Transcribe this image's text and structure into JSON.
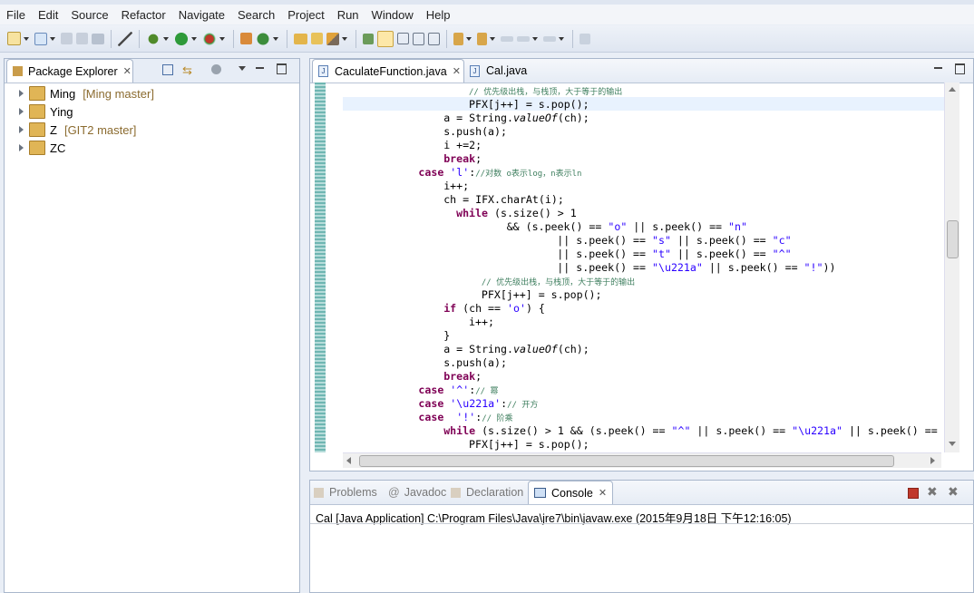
{
  "menu": [
    "File",
    "Edit",
    "Source",
    "Refactor",
    "Navigate",
    "Search",
    "Project",
    "Run",
    "Window",
    "Help"
  ],
  "package_explorer": {
    "tab_label": "Package Explorer",
    "projects": [
      {
        "name": "Ming",
        "branch": "[Ming master]"
      },
      {
        "name": "Ying",
        "branch": ""
      },
      {
        "name": "Z",
        "branch": "[GIT2 master]"
      },
      {
        "name": "ZC",
        "branch": ""
      }
    ]
  },
  "editor": {
    "tabs": [
      "CaculateFunction.java",
      "Cal.java"
    ],
    "lines": [
      {
        "indent": 20,
        "html": "<span class='cm'>// 优先级出栈，与栈顶，大于等于的输出</span>"
      },
      {
        "indent": 20,
        "html": "PFX[j++] = s.pop();",
        "hl": true
      },
      {
        "indent": 16,
        "html": "a = String.<span class='it'>valueOf</span>(ch);"
      },
      {
        "indent": 16,
        "html": "s.push(a);"
      },
      {
        "indent": 16,
        "html": "i +=2;"
      },
      {
        "indent": 16,
        "html": "<span class='kw'>break</span>;"
      },
      {
        "indent": 12,
        "html": "<span class='kw'>case</span> <span class='str'>'l'</span>:<span class='cm'>//对数 o表示log，n表示ln</span>"
      },
      {
        "indent": 16,
        "html": "i++;"
      },
      {
        "indent": 16,
        "html": "ch = IFX.charAt(i);"
      },
      {
        "indent": 18,
        "html": "<span class='kw'>while</span> (s.size() &gt; 1"
      },
      {
        "indent": 26,
        "html": "&amp;&amp; (s.peek() == <span class='str'>\"o\"</span> || s.peek() == <span class='str'>\"n\"</span>"
      },
      {
        "indent": 34,
        "html": "|| s.peek() == <span class='str'>\"s\"</span> || s.peek() == <span class='str'>\"c\"</span>"
      },
      {
        "indent": 34,
        "html": "|| s.peek() == <span class='str'>\"t\"</span> || s.peek() == <span class='str'>\"^\"</span>"
      },
      {
        "indent": 34,
        "html": "|| s.peek() == <span class='str'>\"\\u221a\"</span> || s.peek() == <span class='str'>\"!\"</span>))"
      },
      {
        "indent": 22,
        "html": "<span class='cm'>// 优先级出栈，与栈顶，大于等于的输出</span>"
      },
      {
        "indent": 22,
        "html": "PFX[j++] = s.pop();"
      },
      {
        "indent": 16,
        "html": "<span class='kw'>if</span> (ch == <span class='str'>'o'</span>) {"
      },
      {
        "indent": 20,
        "html": "i++;"
      },
      {
        "indent": 16,
        "html": "}"
      },
      {
        "indent": 16,
        "html": "a = String.<span class='it'>valueOf</span>(ch);"
      },
      {
        "indent": 16,
        "html": "s.push(a);"
      },
      {
        "indent": 16,
        "html": "<span class='kw'>break</span>;"
      },
      {
        "indent": 12,
        "html": "<span class='kw'>case</span> <span class='str'>'^'</span>:<span class='cm'>// 幂</span>"
      },
      {
        "indent": 12,
        "html": "<span class='kw'>case</span> <span class='str'>'\\u221a'</span>:<span class='cm'>// 开方</span>"
      },
      {
        "indent": 12,
        "html": "<span class='kw'>case</span>  <span class='str'>'!'</span>:<span class='cm'>// 阶乘</span>"
      },
      {
        "indent": 16,
        "html": "<span class='kw'>while</span> (s.size() &gt; 1 &amp;&amp; (s.peek() == <span class='str'>\"^\"</span> || s.peek() == <span class='str'>\"\\u221a\"</span> || s.peek() =="
      },
      {
        "indent": 20,
        "html": "PFX[j++] = s.pop();"
      }
    ]
  },
  "bottom_panel": {
    "tabs": [
      "Problems",
      "Javadoc",
      "Declaration",
      "Console"
    ],
    "active_tab": "Console",
    "console_text": "Cal [Java Application] C:\\Program Files\\Java\\jre7\\bin\\javaw.exe (2015年9月18日 下午12:16:05)"
  },
  "colors": {
    "keyword": "#7f0055",
    "string": "#2a00ff",
    "comment": "#3f7f5f",
    "accent": "#3b73b9"
  }
}
